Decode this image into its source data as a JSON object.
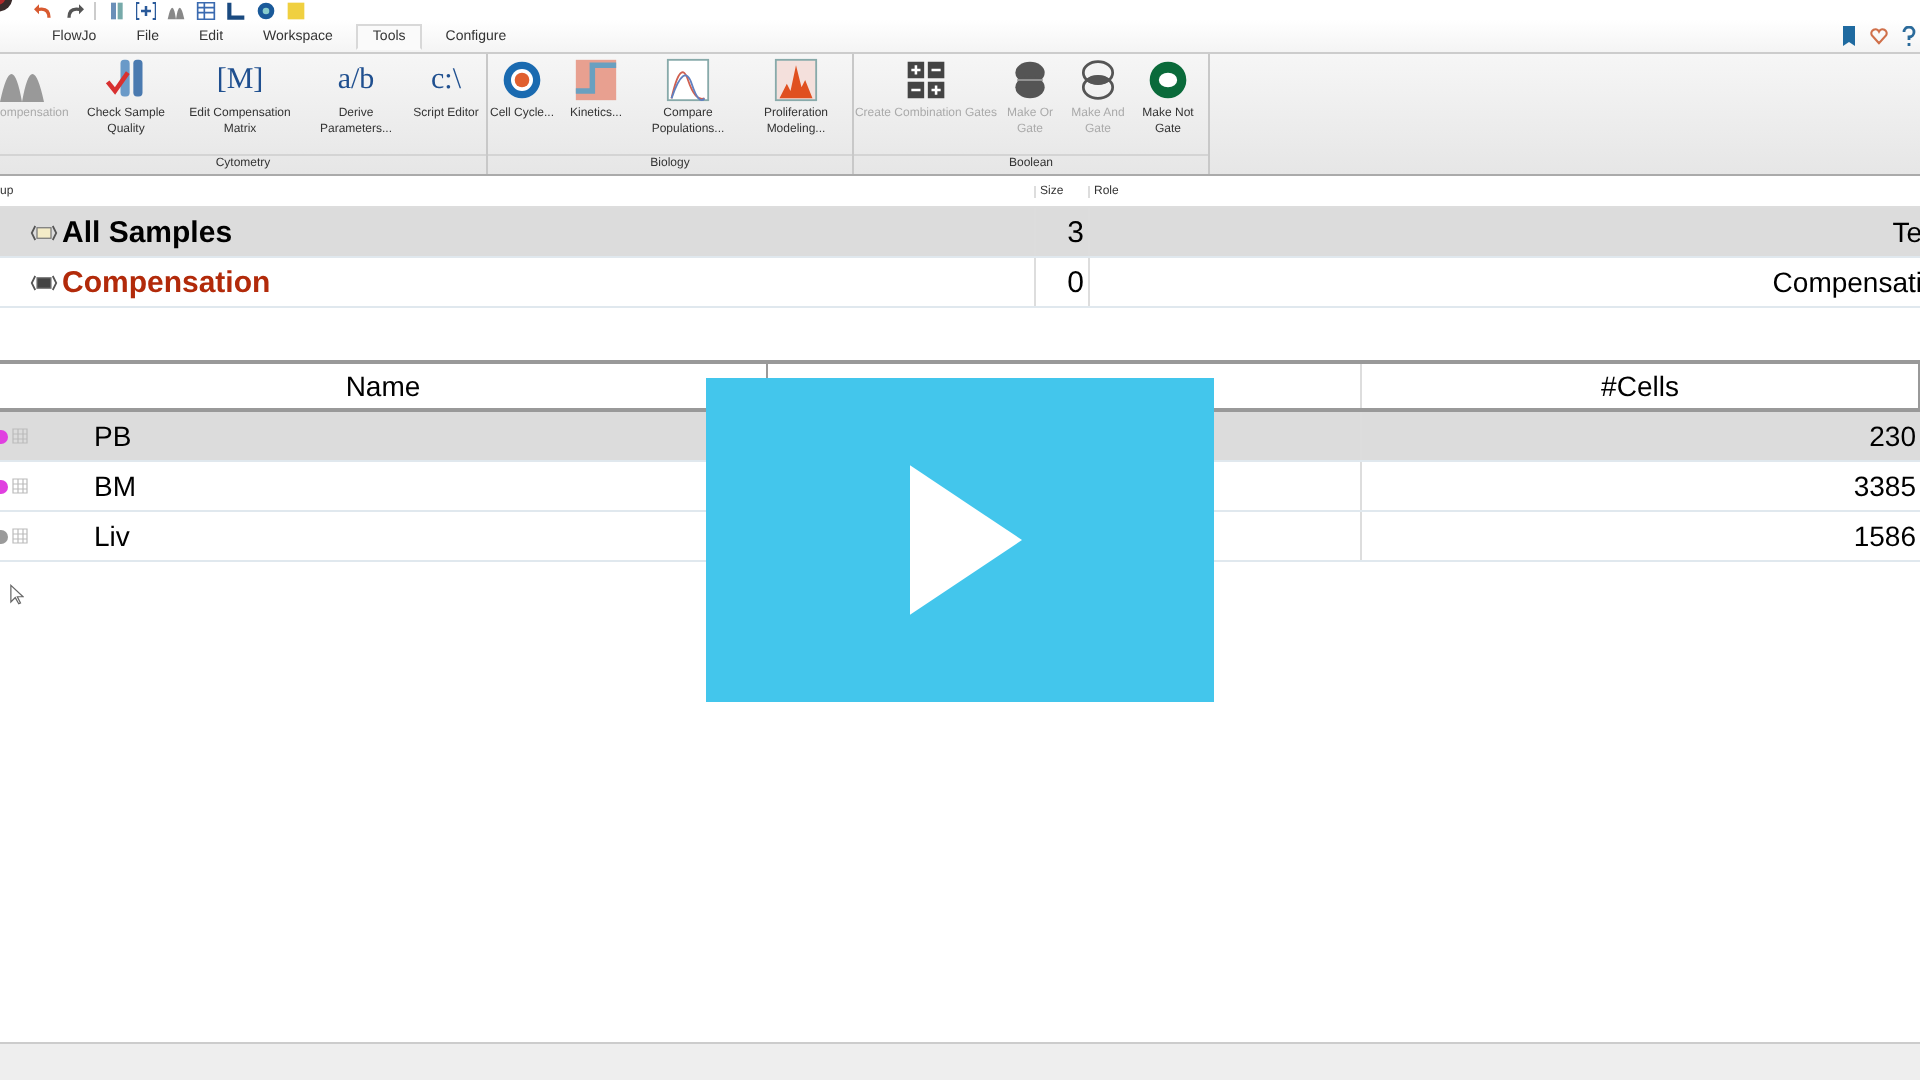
{
  "menu": [
    {
      "label": "FlowJo",
      "selected": false
    },
    {
      "label": "File",
      "selected": false
    },
    {
      "label": "Edit",
      "selected": false
    },
    {
      "label": "Workspace",
      "selected": false
    },
    {
      "label": "Tools",
      "selected": true
    },
    {
      "label": "Configure",
      "selected": false
    }
  ],
  "ribbon": [
    {
      "name": "Cytometry",
      "buttons": [
        {
          "label": "ompensation",
          "disabled": true
        },
        {
          "label": "Check Sample Quality",
          "disabled": false
        },
        {
          "label": "Edit Compensation Matrix",
          "disabled": false,
          "glyph": "[M]"
        },
        {
          "label": "Derive Parameters...",
          "disabled": false,
          "glyph": "a/b"
        },
        {
          "label": "Script Editor",
          "disabled": false,
          "glyph": "c:\\"
        }
      ]
    },
    {
      "name": "Biology",
      "buttons": [
        {
          "label": "Cell Cycle...",
          "disabled": false
        },
        {
          "label": "Kinetics...",
          "disabled": false
        },
        {
          "label": "Compare Populations...",
          "disabled": false
        },
        {
          "label": "Proliferation Modeling...",
          "disabled": false
        }
      ]
    },
    {
      "name": "Boolean",
      "buttons": [
        {
          "label": "Create Combination Gates",
          "disabled": true
        },
        {
          "label": "Make Or Gate",
          "disabled": true
        },
        {
          "label": "Make And Gate",
          "disabled": true
        },
        {
          "label": "Make Not Gate",
          "disabled": false
        }
      ]
    }
  ],
  "groups_table": {
    "columns": [
      "up",
      "Size",
      "Role"
    ],
    "rows": [
      {
        "name": "All Samples",
        "size": "3",
        "role": "Te",
        "kind": "all",
        "selected": true
      },
      {
        "name": "Compensation",
        "size": "0",
        "role": "Compensati",
        "kind": "compensation",
        "selected": false
      }
    ]
  },
  "samples_table": {
    "columns": [
      "Name",
      "#Cells"
    ],
    "rows": [
      {
        "name": "PB",
        "cells": "230",
        "color": "#e040e0",
        "selected": true
      },
      {
        "name": "BM",
        "cells": "3385",
        "color": "#e040e0",
        "selected": false
      },
      {
        "name": "Liv",
        "cells": "1586",
        "color": "#9a9a9a",
        "selected": false
      }
    ]
  },
  "video": {
    "playing": false
  }
}
